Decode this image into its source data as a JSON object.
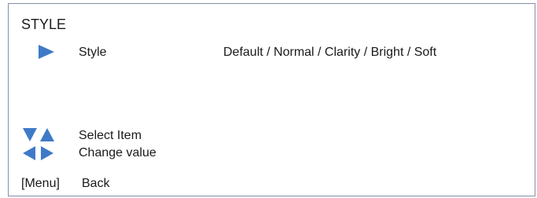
{
  "menu": {
    "title": "STYLE",
    "items": [
      {
        "label": "Style",
        "options": "Default / Normal / Clarity / Bright / Soft",
        "selected": true
      }
    ]
  },
  "legend": {
    "select_item": "Select Item",
    "change_value": "Change value",
    "menu_key": "[Menu]",
    "back": "Back"
  },
  "colors": {
    "accent": "#3f7ac8",
    "frame_border": "#7f8fa6",
    "text": "#1a1a1a"
  },
  "icons": {
    "selected_item": "triangle-right-icon",
    "select_keys": [
      "triangle-down-icon",
      "triangle-up-icon"
    ],
    "change_keys": [
      "triangle-left-icon",
      "triangle-right-icon"
    ]
  }
}
